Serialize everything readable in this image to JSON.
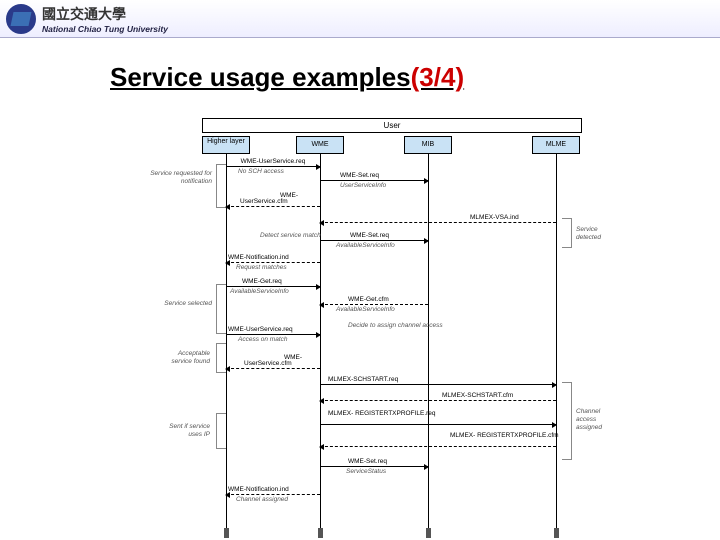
{
  "header": {
    "university_zh": "國立交通大學",
    "university_en": "National Chiao Tung University"
  },
  "title_main": "Service usage examples",
  "title_suffix": "(3/4)",
  "diagram": {
    "container": "User",
    "actors": [
      "Higher layer",
      "WME",
      "MIB",
      "MLME"
    ],
    "braces": {
      "b0": "Service\nrequested for\nnotification",
      "b1": "Service\nselected",
      "b2": "Acceptable\nservice found",
      "b3": "Sent if service\nuses IP",
      "b4": "Service\ndetected",
      "b5": "Channel\naccess\nassigned"
    },
    "msgs": {
      "m0": "WME-UserService.req",
      "m1": "No SCH access",
      "m2": "WME-Set.req",
      "m3": "UserServiceInfo",
      "m4": "WME-",
      "m5": "UserService.cfm",
      "m6": "MLMEX-VSA.ind",
      "m7": "WME-Set.req",
      "m8": "Detect service\nmatch",
      "m9": "AvailableServiceInfo",
      "m10": "WME-Notification.ind",
      "m11": "Request matches",
      "m12": "WME-Get.req",
      "m13": "AvailableServiceInfo",
      "m14": "WME-Get.cfm",
      "m15": "AvailableServiceInfo",
      "m16": "WME-UserService.req",
      "m17": "Access on match",
      "m18": "Decide to\nassign channel\naccess",
      "m19": "WME-",
      "m20": "UserService.cfm",
      "m21": "MLMEX-SCHSTART.req",
      "m22": "MLMEX-SCHSTART.cfm",
      "m23": "MLMEX-\nREGISTERTXPROFILE.req",
      "m24": "MLMEX-\nREGISTERTXPROFILE.cfm",
      "m25": "WME-Set.req",
      "m26": "ServiceStatus",
      "m27": "WME-Notification.ind",
      "m28": "Channel assigned"
    }
  }
}
